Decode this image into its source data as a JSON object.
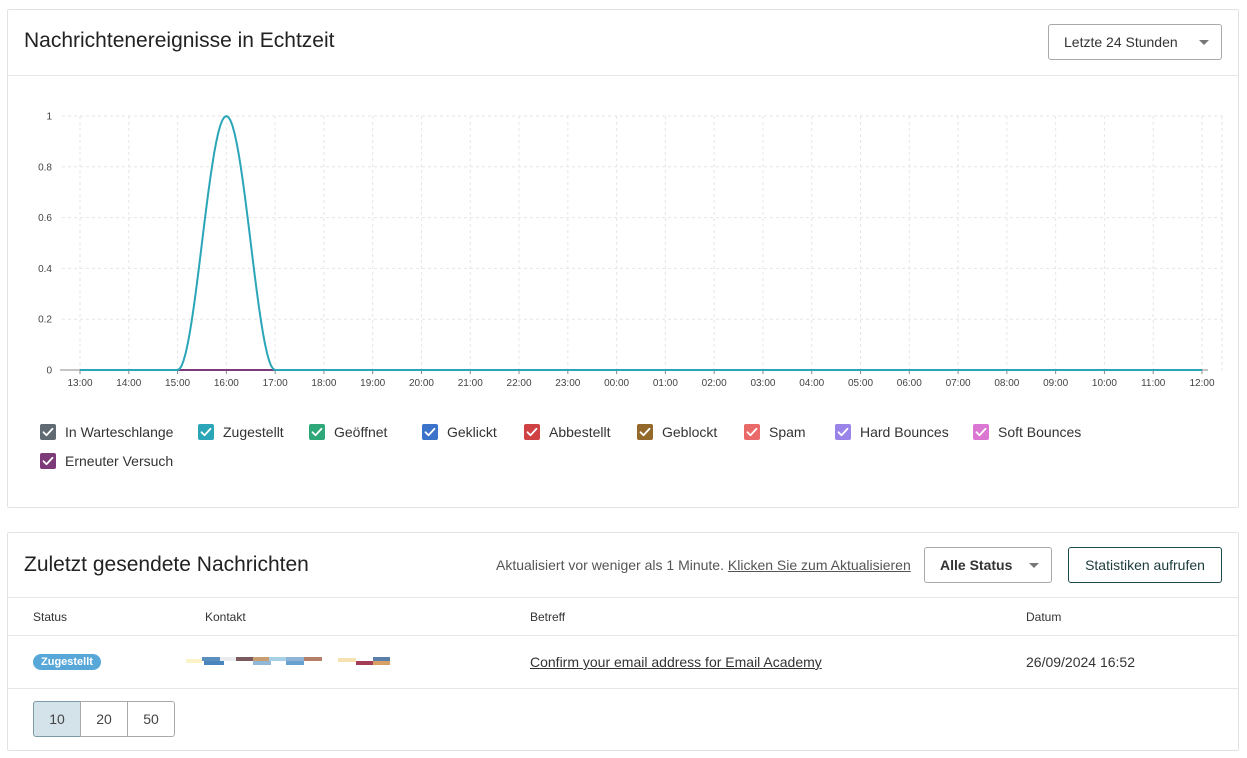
{
  "events_panel": {
    "title": "Nachrichtenereignisse in Echtzeit",
    "range_select": "Letzte 24 Stunden"
  },
  "chart_data": {
    "type": "line",
    "x": [
      "13:00",
      "14:00",
      "15:00",
      "16:00",
      "17:00",
      "18:00",
      "19:00",
      "20:00",
      "21:00",
      "22:00",
      "23:00",
      "00:00",
      "01:00",
      "02:00",
      "03:00",
      "04:00",
      "05:00",
      "06:00",
      "07:00",
      "08:00",
      "09:00",
      "10:00",
      "11:00",
      "12:00"
    ],
    "yticks": [
      "0",
      "0.2",
      "0.4",
      "0.6",
      "0.8",
      "1"
    ],
    "ylim": [
      0,
      1
    ],
    "grid": true,
    "series": [
      {
        "name": "In Warteschlange",
        "color": "#5f6a73",
        "values": [
          0,
          0,
          0,
          0,
          0,
          0,
          0,
          0,
          0,
          0,
          0,
          0,
          0,
          0,
          0,
          0,
          0,
          0,
          0,
          0,
          0,
          0,
          0,
          0
        ]
      },
      {
        "name": "Zugestellt",
        "color": "#2aa6b8",
        "values": [
          0,
          0,
          0,
          1,
          0,
          0,
          0,
          0,
          0,
          0,
          0,
          0,
          0,
          0,
          0,
          0,
          0,
          0,
          0,
          0,
          0,
          0,
          0,
          0
        ]
      },
      {
        "name": "Geöffnet",
        "color": "#2ea879",
        "values": [
          0,
          0,
          0,
          0,
          0,
          0,
          0,
          0,
          0,
          0,
          0,
          0,
          0,
          0,
          0,
          0,
          0,
          0,
          0,
          0,
          0,
          0,
          0,
          0
        ]
      },
      {
        "name": "Geklickt",
        "color": "#3a73c9",
        "values": [
          0,
          0,
          0,
          0,
          0,
          0,
          0,
          0,
          0,
          0,
          0,
          0,
          0,
          0,
          0,
          0,
          0,
          0,
          0,
          0,
          0,
          0,
          0,
          0
        ]
      },
      {
        "name": "Abbestellt",
        "color": "#cf4143",
        "values": [
          0,
          0,
          0,
          0,
          0,
          0,
          0,
          0,
          0,
          0,
          0,
          0,
          0,
          0,
          0,
          0,
          0,
          0,
          0,
          0,
          0,
          0,
          0,
          0
        ]
      },
      {
        "name": "Geblockt",
        "color": "#93692b",
        "values": [
          0,
          0,
          0,
          0,
          0,
          0,
          0,
          0,
          0,
          0,
          0,
          0,
          0,
          0,
          0,
          0,
          0,
          0,
          0,
          0,
          0,
          0,
          0,
          0
        ]
      },
      {
        "name": "Spam",
        "color": "#e96a69",
        "values": [
          0,
          0,
          0,
          0,
          0,
          0,
          0,
          0,
          0,
          0,
          0,
          0,
          0,
          0,
          0,
          0,
          0,
          0,
          0,
          0,
          0,
          0,
          0,
          0
        ]
      },
      {
        "name": "Hard Bounces",
        "color": "#9a84ea",
        "values": [
          0,
          0,
          0,
          0,
          0,
          0,
          0,
          0,
          0,
          0,
          0,
          0,
          0,
          0,
          0,
          0,
          0,
          0,
          0,
          0,
          0,
          0,
          0,
          0
        ]
      },
      {
        "name": "Soft Bounces",
        "color": "#db77d3",
        "values": [
          0,
          0,
          0,
          0,
          0,
          0,
          0,
          0,
          0,
          0,
          0,
          0,
          0,
          0,
          0,
          0,
          0,
          0,
          0,
          0,
          0,
          0,
          0,
          0
        ]
      },
      {
        "name": "Erneuter Versuch",
        "color": "#7d3a78",
        "values": [
          0,
          0,
          0,
          0,
          0,
          0,
          0,
          0,
          0,
          0,
          0,
          0,
          0,
          0,
          0,
          0,
          0,
          0,
          0,
          0,
          0,
          0,
          0,
          0
        ]
      }
    ]
  },
  "recent_panel": {
    "title": "Zuletzt gesendete Nachrichten",
    "refresh_text": "Aktualisiert vor weniger als 1 Minute.",
    "refresh_link": "Klicken Sie zum Aktualisieren",
    "status_select": "Alle Status",
    "stats_button": "Statistiken aufrufen",
    "columns": [
      "Status",
      "Kontakt",
      "Betreff",
      "Datum"
    ],
    "rows": [
      {
        "status": "Zugestellt",
        "status_color": "#58a7d9",
        "subject": "Confirm your email address for Email Academy",
        "date": "26/09/2024 16:52"
      }
    ],
    "page_sizes": [
      "10",
      "20",
      "50"
    ],
    "active_page_size": "10"
  }
}
